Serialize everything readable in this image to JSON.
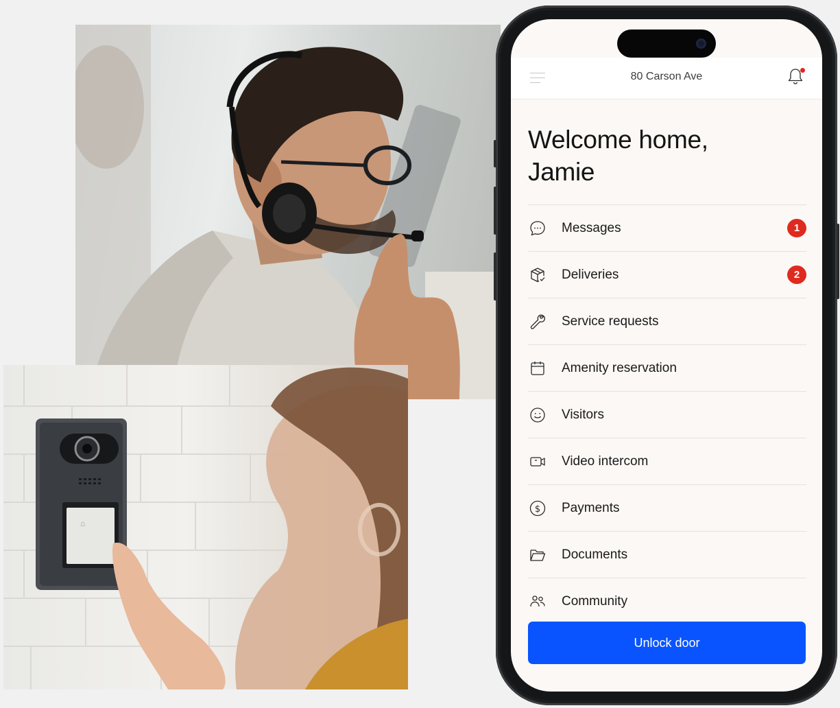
{
  "photos": {
    "agent": {
      "icon": "photo-support-agent"
    },
    "intercom": {
      "icon": "photo-video-intercom",
      "button_icon": "key-card-icon"
    }
  },
  "app": {
    "header": {
      "title": "80 Carson Ave",
      "menu_icon": "hamburger-icon",
      "notification_icon": "bell-icon",
      "has_unread": true
    },
    "welcome": {
      "line1": "Welcome home,",
      "line2": "Jamie"
    },
    "menu": [
      {
        "label": "Messages",
        "icon": "chat-bubble-icon",
        "badge": "1"
      },
      {
        "label": "Deliveries",
        "icon": "package-icon",
        "badge": "2"
      },
      {
        "label": "Service requests",
        "icon": "wrench-icon"
      },
      {
        "label": "Amenity reservation",
        "icon": "calendar-icon"
      },
      {
        "label": "Visitors",
        "icon": "smiley-icon"
      },
      {
        "label": "Video intercom",
        "icon": "video-camera-icon"
      },
      {
        "label": "Payments",
        "icon": "dollar-circle-icon"
      },
      {
        "label": "Documents",
        "icon": "folder-icon"
      },
      {
        "label": "Community",
        "icon": "people-icon"
      }
    ],
    "unlock_label": "Unlock door"
  },
  "colors": {
    "accent": "#0a54ff",
    "badge": "#df2a1f",
    "screen_bg": "#fbf8f5"
  }
}
